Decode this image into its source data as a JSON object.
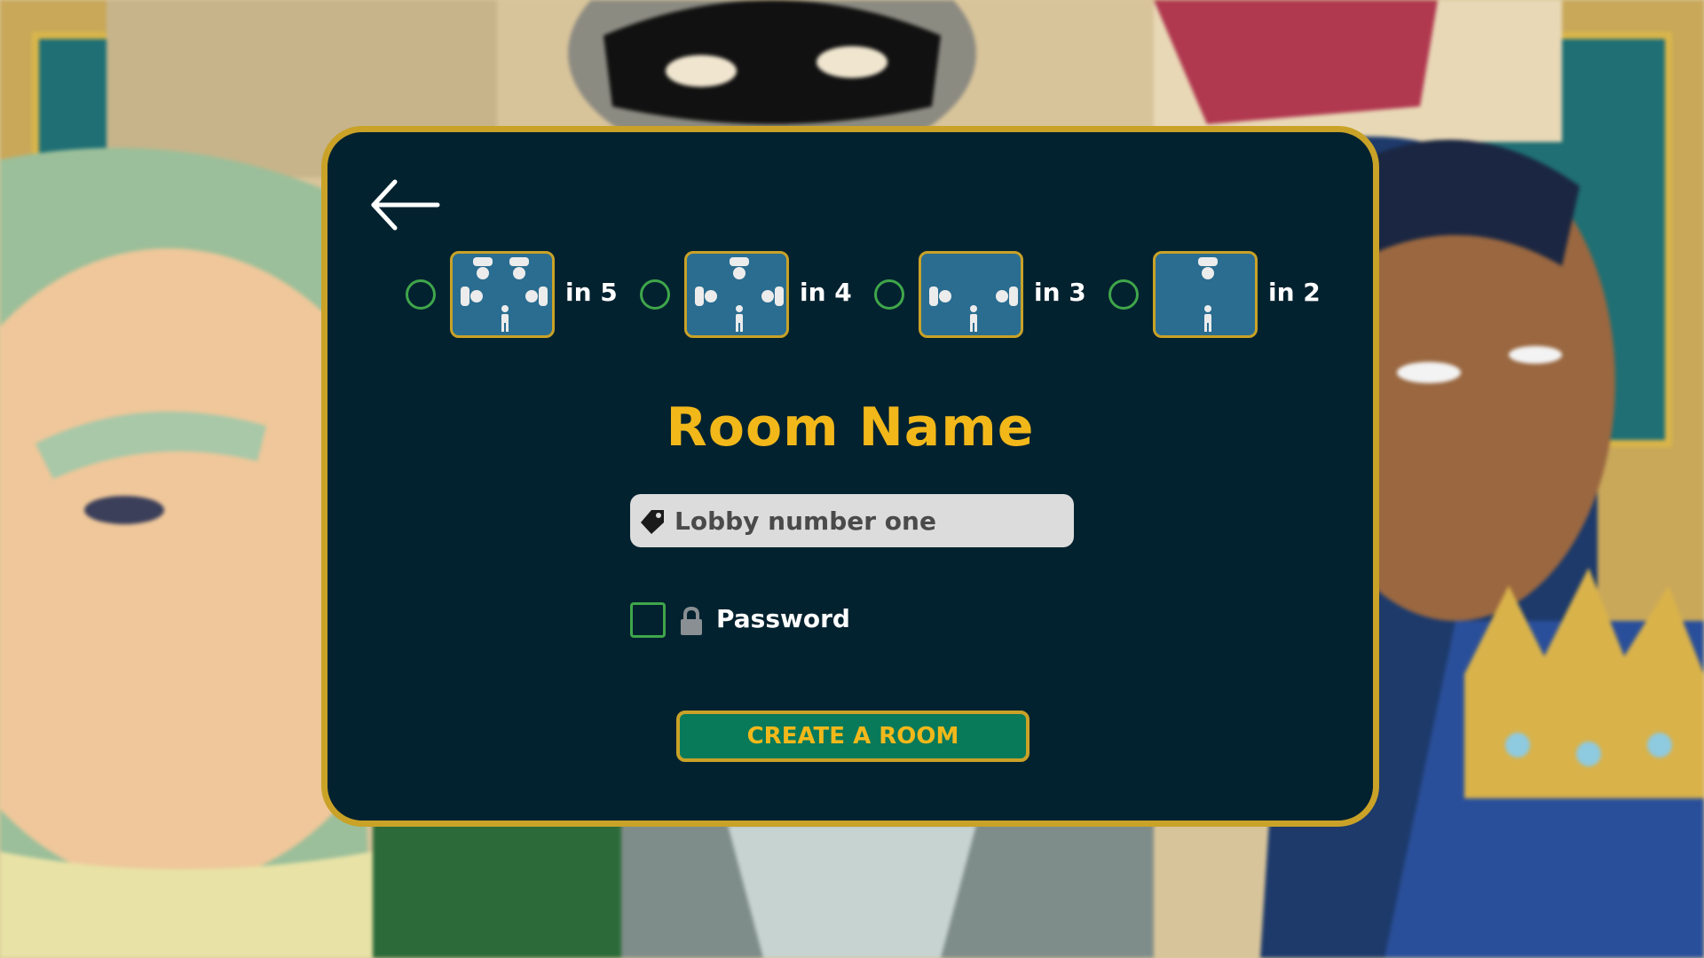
{
  "modal": {
    "title": "Room Name",
    "back_icon": "arrow-left-icon"
  },
  "player_options": [
    {
      "label": "in 5",
      "players": 5,
      "selected": false
    },
    {
      "label": "in 4",
      "players": 4,
      "selected": false
    },
    {
      "label": "in 3",
      "players": 3,
      "selected": false
    },
    {
      "label": "in 2",
      "players": 2,
      "selected": false
    }
  ],
  "room_name": {
    "value": "Lobby number one",
    "icon": "tag-icon"
  },
  "password": {
    "label": "Password",
    "checked": false,
    "icon": "lock-icon"
  },
  "create_button": {
    "label": "CREATE A ROOM"
  },
  "colors": {
    "panel": "#03222f",
    "gold_border": "#c9a227",
    "title_yellow": "#f2b81a",
    "tile_blue": "#2a6d90",
    "radio_green": "#3fa64a",
    "button_green": "#087a5a"
  }
}
